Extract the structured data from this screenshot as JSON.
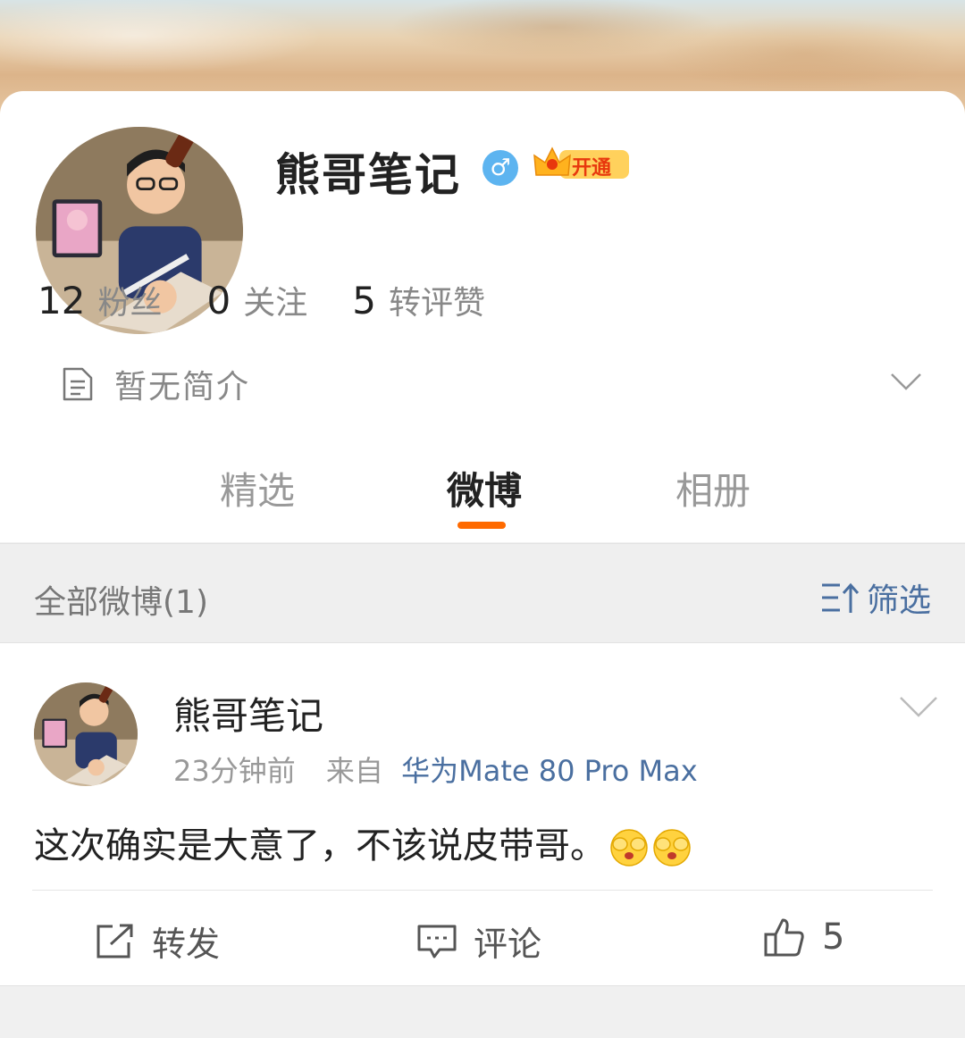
{
  "profile": {
    "name": "熊哥笔记",
    "gender_symbol": "♂",
    "vip_label": "开通",
    "stats": [
      {
        "num": "12",
        "label": "粉丝"
      },
      {
        "num": "0",
        "label": "关注"
      },
      {
        "num": "5",
        "label": "转评赞"
      }
    ],
    "bio": "暂无简介"
  },
  "tabs": [
    {
      "label": "精选",
      "active": false
    },
    {
      "label": "微博",
      "active": true
    },
    {
      "label": "相册",
      "active": false
    }
  ],
  "filter": {
    "title": "全部微博(1)",
    "button_label": "筛选"
  },
  "post": {
    "author": "熊哥笔记",
    "time": "23分钟前",
    "from_label": "来自",
    "source": "华为Mate 80 Pro Max",
    "text": "这次确实是大意了，不该说皮带哥。",
    "actions": {
      "repost": "转发",
      "comment": "评论",
      "like_count": "5"
    }
  },
  "colors": {
    "accent_orange": "#ff6a00",
    "link_blue": "#4a6fa0",
    "gender_blue": "#5db4f0"
  }
}
